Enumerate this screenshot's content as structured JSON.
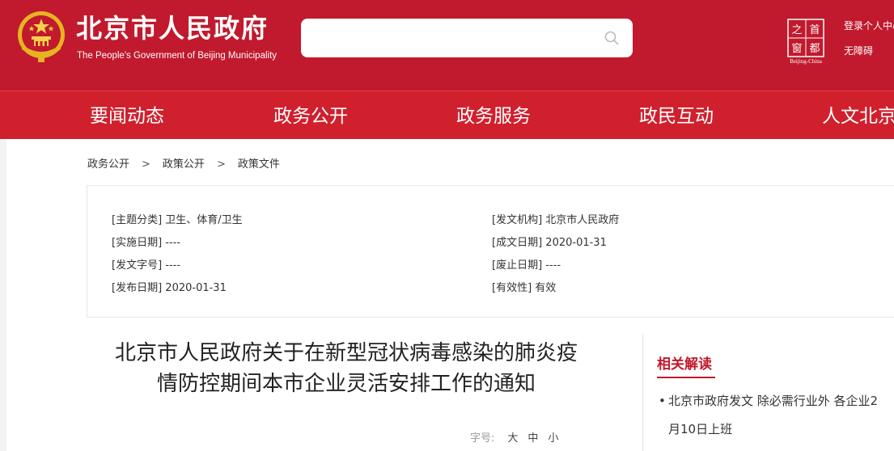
{
  "header": {
    "title": "北京市人民政府",
    "subtitle": "The People's Government of Beijing Municipality",
    "search": {
      "value": "",
      "placeholder": ""
    },
    "capital_logo_chars": [
      "之",
      "首",
      "都",
      "窗"
    ],
    "capital_logo_text": "Beijing-China",
    "login_label": "登录个人中心",
    "accessibility_label": "无障碍"
  },
  "nav": {
    "items": [
      "要闻动态",
      "政务公开",
      "政务服务",
      "政民互动",
      "人文北京"
    ]
  },
  "breadcrumb": {
    "items": [
      "政务公开",
      "政策公开",
      "政策文件"
    ],
    "separator": ">"
  },
  "meta": {
    "topic_key": "[主题分类]",
    "topic_value": "卫生、体育/卫生",
    "issuer_key": "[发文机构]",
    "issuer_value": "北京市人民政府",
    "effective_key": "[实施日期]",
    "effective_value": "----",
    "written_key": "[成文日期]",
    "written_value": "2020-01-31",
    "docnum_key": "[发文字号]",
    "docnum_value": "----",
    "repeal_key": "[废止日期]",
    "repeal_value": "----",
    "publish_key": "[发布日期]",
    "publish_value": "2020-01-31",
    "validity_key": "[有效性]",
    "validity_value": "有效"
  },
  "article": {
    "title_line1": "北京市人民政府关于在新型冠状病毒感染的肺炎疫",
    "title_line2": "情防控期间本市企业灵活安排工作的通知"
  },
  "font_size": {
    "label": "字号:",
    "large": "大",
    "medium": "中",
    "small": "小"
  },
  "related": {
    "heading": "相关解读",
    "items": [
      {
        "line1": "北京市政府发文 除必需行业外 各企业2",
        "line2": "月10日上班"
      }
    ]
  },
  "colors": {
    "header_red": "#c1192d",
    "nav_red": "#d0202d",
    "accent": "#c1192d"
  }
}
